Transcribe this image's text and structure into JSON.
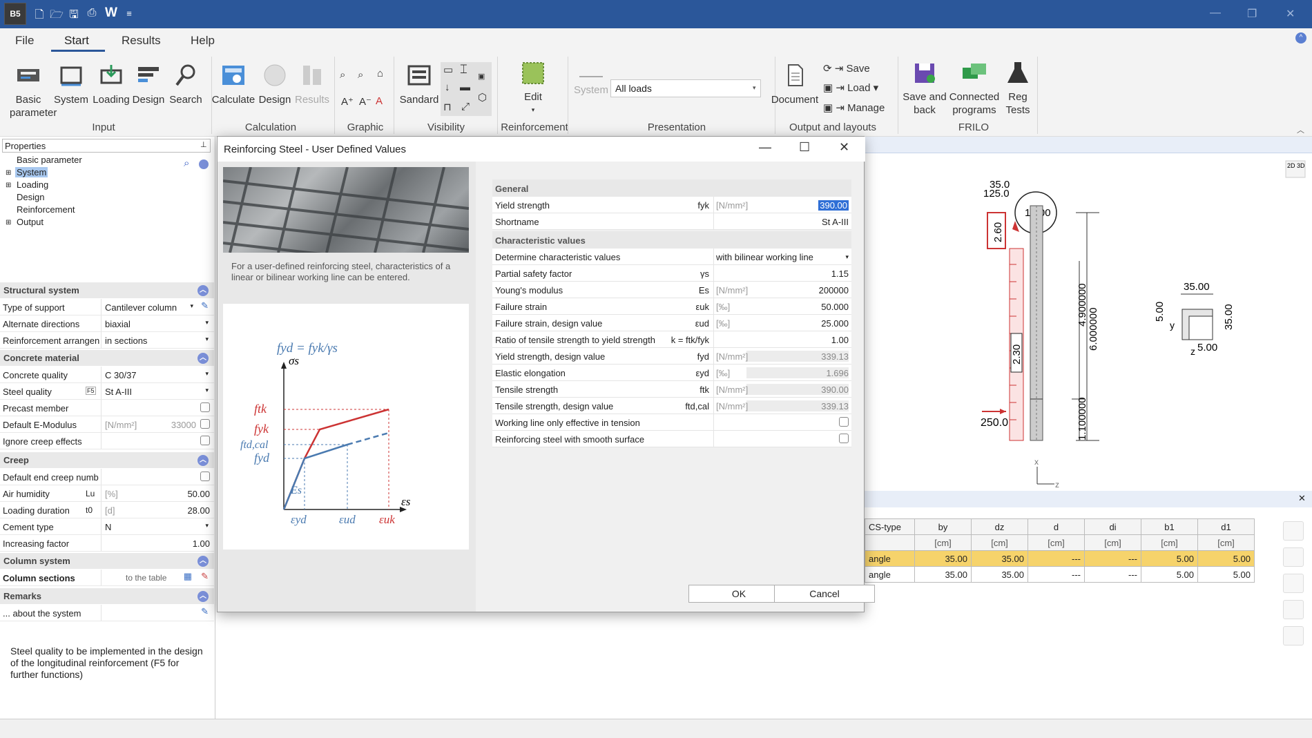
{
  "titlebar": {
    "app_icon": "B5",
    "quick_access": [
      "new-file-icon",
      "open-folder-icon",
      "save-icon",
      "print-icon",
      "word-icon",
      "customize-icon"
    ],
    "word_label": "W",
    "customize": "≡"
  },
  "menu_tabs": [
    "File",
    "Start",
    "Results",
    "Help"
  ],
  "ribbon": {
    "input": {
      "group": "Input",
      "buttons": [
        "Basic parameter",
        "System",
        "Loading",
        "Design",
        "Search"
      ]
    },
    "calculation": {
      "group": "Calculation",
      "buttons": [
        "Calculate",
        "Design",
        "Results"
      ]
    },
    "graphic": {
      "group": "Graphic"
    },
    "visibility": {
      "group": "Visibility",
      "button": "Sandard"
    },
    "reinforcement": {
      "group": "Reinforcement",
      "button": "Edit"
    },
    "presentation": {
      "group": "Presentation",
      "system_label": "System",
      "loads_value": "All loads"
    },
    "output": {
      "group": "Output and layouts",
      "document": "Document",
      "save": "Save",
      "load": "Load",
      "manage": "Manage"
    },
    "frilo": {
      "group": "FRILO",
      "save_back": "Save and back",
      "connected": "Connected programs",
      "reg_tests": "Reg Tests"
    }
  },
  "properties": {
    "header": "Properties",
    "tree": [
      "Basic parameter",
      "System",
      "Loading",
      "Design",
      "Reinforcement",
      "Output"
    ],
    "structural_system": {
      "title": "Structural system",
      "type_of_support": {
        "label": "Type of support",
        "value": "Cantilever column"
      },
      "alternate_directions": {
        "label": "Alternate directions",
        "value": "biaxial"
      },
      "reinforcement_arrangement": {
        "label": "Reinforcement arrangen",
        "value": "in sections"
      }
    },
    "concrete_material": {
      "title": "Concrete material",
      "concrete_quality": {
        "label": "Concrete quality",
        "value": "C 30/37"
      },
      "steel_quality": {
        "label": "Steel quality",
        "value": "St A-III",
        "key": "F5"
      },
      "precast": {
        "label": "Precast member"
      },
      "default_e": {
        "label": "Default E-Modulus",
        "unit": "[N/mm²]",
        "value": "33000"
      },
      "ignore_creep": {
        "label": "Ignore creep effects"
      }
    },
    "creep": {
      "title": "Creep",
      "default_end": {
        "label": "Default end creep numb"
      },
      "air_humidity": {
        "label": "Air humidity",
        "sym": "Lu",
        "unit": "[%]",
        "value": "50.00"
      },
      "loading_duration": {
        "label": "Loading duration",
        "sym": "t0",
        "unit": "[d]",
        "value": "28.00"
      },
      "cement_type": {
        "label": "Cement type",
        "value": "N"
      },
      "increasing_factor": {
        "label": "Increasing factor",
        "value": "1.00"
      }
    },
    "column_system": {
      "title": "Column system",
      "column_sections": "Column sections",
      "to_table": "to the table"
    },
    "remarks": {
      "title": "Remarks",
      "about": "... about the system"
    },
    "hint": "Steel quality to be implemented in the design of the longitudinal reinforcement (F5 for further functions)"
  },
  "graphic_view": {
    "labels": {
      "top1": "35.0",
      "top2": "125.0",
      "circle": "12.00",
      "l260": "2.60",
      "l230": "2.30",
      "l250": "250.0",
      "d49": "4.900000",
      "d60": "6.000000",
      "d11": "1.100000",
      "b35": "35.00",
      "h35": "35.00",
      "c5a": "5.00",
      "c5b": "5.00",
      "y": "y",
      "z": "z",
      "x": "x",
      "z2": "z",
      "view": "2D 3D"
    }
  },
  "cs_table": {
    "headers": [
      "CS-type",
      "by",
      "dz",
      "d",
      "di",
      "b1",
      "d1"
    ],
    "units": [
      "",
      "[cm]",
      "[cm]",
      "[cm]",
      "[cm]",
      "[cm]",
      "[cm]"
    ],
    "rows": [
      [
        "angle",
        "35.00",
        "35.00",
        "---",
        "---",
        "5.00",
        "5.00"
      ],
      [
        "angle",
        "35.00",
        "35.00",
        "---",
        "---",
        "5.00",
        "5.00"
      ]
    ]
  },
  "dialog": {
    "title": "Reinforcing Steel - User Defined Values",
    "description": "For a user-defined reinforcing steel, characteristics of a linear or bilinear working line can be entered.",
    "diagram": {
      "formula": "fyd = fyk/γs",
      "sigma": "σs",
      "eps": "εs",
      "ftk": "ftk",
      "fyk": "fyk",
      "ftdcal": "ftd,cal",
      "fyd": "fyd",
      "Es": "Es",
      "eyd": "εyd",
      "eud": "εud",
      "euk": "εuk"
    },
    "general": {
      "title": "General",
      "yield_strength": {
        "name": "Yield strength",
        "sym": "fyk",
        "unit": "[N/mm²]",
        "value": "390.00"
      },
      "shortname": {
        "name": "Shortname",
        "value": "St A-III"
      }
    },
    "characteristic": {
      "title": "Characteristic values",
      "determine": {
        "name": "Determine characteristic values",
        "value": "with bilinear working line"
      },
      "rows": [
        {
          "name": "Partial safety factor",
          "sym": "γs",
          "unit": "",
          "value": "1.15",
          "ro": false
        },
        {
          "name": "Young's modulus",
          "sym": "Es",
          "unit": "[N/mm²]",
          "value": "200000",
          "ro": false
        },
        {
          "name": "Failure strain",
          "sym": "εuk",
          "unit": "[‰]",
          "value": "50.000",
          "ro": false
        },
        {
          "name": "Failure strain, design value",
          "sym": "εud",
          "unit": "[‰]",
          "value": "25.000",
          "ro": false
        },
        {
          "name": "Ratio of tensile strength to yield strength",
          "sym": "k = ftk/fyk",
          "unit": "",
          "value": "1.00",
          "ro": false
        },
        {
          "name": "Yield strength, design value",
          "sym": "fyd",
          "unit": "[N/mm²]",
          "value": "339.13",
          "ro": true
        },
        {
          "name": "Elastic elongation",
          "sym": "εyd",
          "unit": "[‰]",
          "value": "1.696",
          "ro": true
        },
        {
          "name": "Tensile strength",
          "sym": "ftk",
          "unit": "[N/mm²]",
          "value": "390.00",
          "ro": true
        },
        {
          "name": "Tensile strength, design value",
          "sym": "ftd,cal",
          "unit": "[N/mm²]",
          "value": "339.13",
          "ro": true
        }
      ],
      "tension_only": "Working line only effective in tension",
      "smooth": "Reinforcing steel with smooth surface"
    },
    "ok": "OK",
    "cancel": "Cancel"
  }
}
